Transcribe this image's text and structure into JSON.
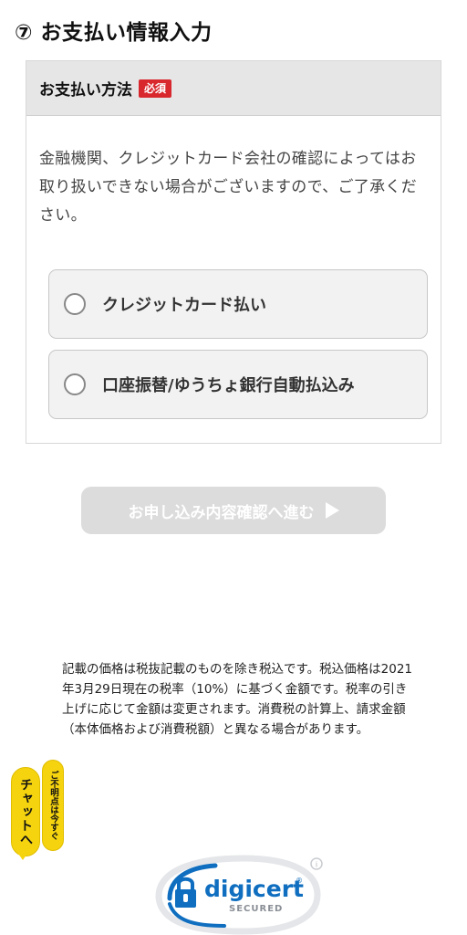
{
  "section": {
    "title": "⑦ お支払い情報入力"
  },
  "payment": {
    "header": "お支払い方法",
    "required_badge": "必須",
    "notice": "金融機関、クレジットカード会社の確認によってはお取り扱いできない場合がございますので、ご了承ください。",
    "options": [
      {
        "label": "クレジットカード払い",
        "selected": false
      },
      {
        "label": "口座振替/ゆうちょ銀行自動払込み",
        "selected": false
      }
    ]
  },
  "confirm_button": {
    "label": "お申し込み内容確認へ進む",
    "enabled": false
  },
  "tax_note": "記載の価格は税抜記載のものを除き税込です。税込価格は2021年3月29日現在の税率（10%）に基づく金額です。税率の引き上げに応じて金額は変更されます。消費税の計算上、請求金額（本体価格および消費税額）と異なる場合があります。",
  "chat": {
    "main_label": "チャットへ",
    "sub_label": "ご不明点は今すぐ"
  },
  "seal": {
    "brand": "digicert",
    "registered_mark": "®",
    "status": "SECURED",
    "info_mark": "i"
  },
  "colors": {
    "required_badge": "#d9272e",
    "chat_yellow": "#f5d40f",
    "digicert_blue": "#0f6ebf",
    "button_disabled": "#dcdcdc"
  }
}
